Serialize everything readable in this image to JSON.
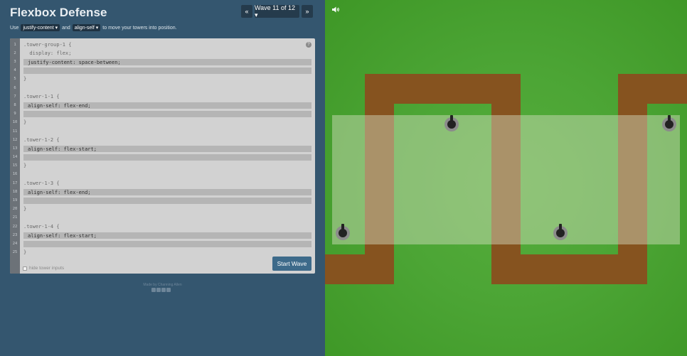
{
  "header": {
    "title": "Flexbox Defense",
    "prev_label": "«",
    "wave_label": "Wave 11 of 12 ▾",
    "next_label": "»"
  },
  "instructions": {
    "use": "Use",
    "prop1": "justify-content ▾",
    "and": "and",
    "prop2": "align-self ▾",
    "rest": "to move your towers into position."
  },
  "editor": {
    "line_numbers": [
      "1",
      "2",
      "3",
      "4",
      "5",
      "6",
      "7",
      "8",
      "9",
      "10",
      "11",
      "12",
      "13",
      "14",
      "15",
      "16",
      "17",
      "18",
      "19",
      "20",
      "21",
      "22",
      "23",
      "24",
      "25"
    ],
    "help_icon": "?",
    "lines": {
      "l1": ".tower-group-1 {",
      "l2": "  display: flex;",
      "l3": "justify-content: space-between;",
      "l5": "}",
      "l7": ".tower-1-1 {",
      "l8": "align-self: flex-end;",
      "l10": "}",
      "l12": ".tower-1-2 {",
      "l13": "align-self: flex-start;",
      "l15": "}",
      "l17": ".tower-1-3 {",
      "l18": "align-self: flex-end;",
      "l20": "}",
      "l22": ".tower-1-4 {",
      "l23": "align-self: flex-start;",
      "l25": "}"
    },
    "start_button": "Start Wave",
    "hide_inputs_label": "hide tower inputs"
  },
  "footer": {
    "credit": "Made by Channing Allen"
  },
  "board": {
    "sound_icon": "speaker-icon",
    "path_color": "#86531f",
    "grass_color": "#4ca535",
    "towers": [
      {
        "name": "tower-1-1",
        "align_self": "flex-end"
      },
      {
        "name": "tower-1-2",
        "align_self": "flex-start"
      },
      {
        "name": "tower-1-3",
        "align_self": "flex-end"
      },
      {
        "name": "tower-1-4",
        "align_self": "flex-start"
      }
    ]
  },
  "colors": {
    "panel_bg": "#34566f",
    "editor_bg": "#d2d2d2",
    "button_bg": "#3d6a8a"
  }
}
